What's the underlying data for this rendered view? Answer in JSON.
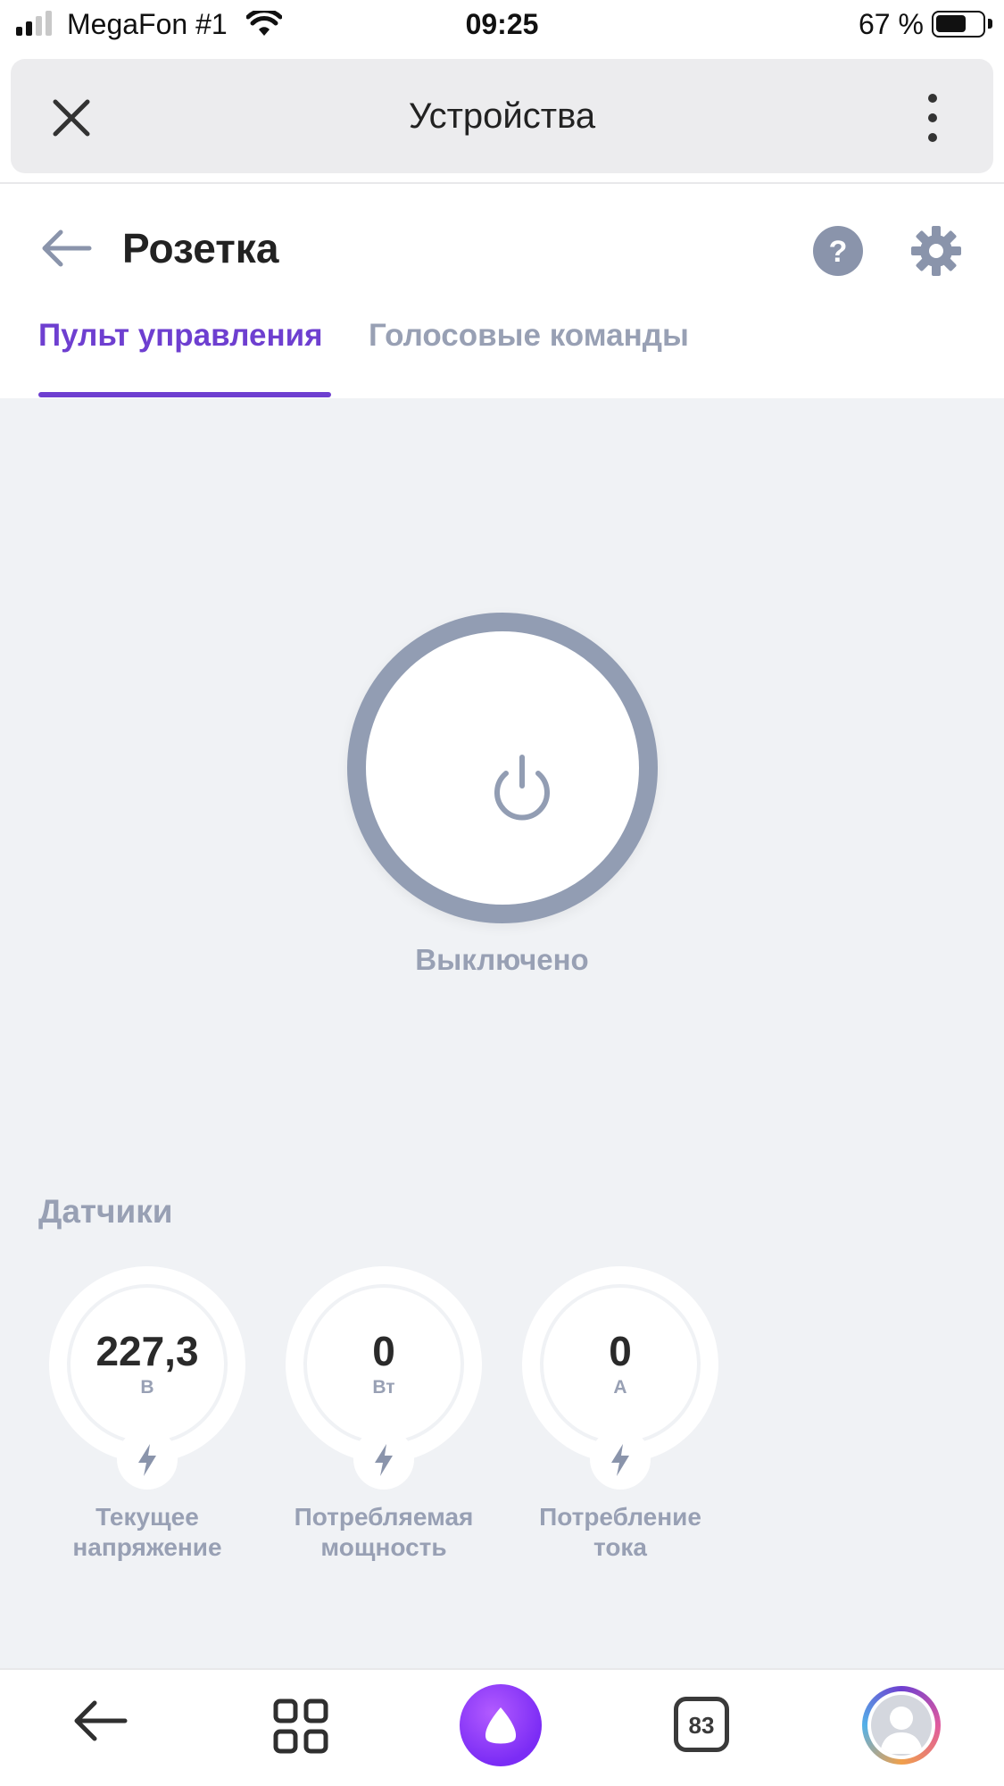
{
  "status_bar": {
    "carrier": "MegaFon #1",
    "time": "09:25",
    "battery_percent": "67 %",
    "battery_level": 0.67,
    "signal_bars": 2
  },
  "header": {
    "title": "Устройства",
    "close_icon": "close-icon",
    "more_icon": "more-vertical-icon"
  },
  "device": {
    "title": "Розетка",
    "tabs": [
      {
        "label": "Пульт управления",
        "active": true
      },
      {
        "label": "Голосовые команды",
        "active": false
      }
    ],
    "accent_color": "#6e3fd0"
  },
  "power": {
    "state_label": "Выключено",
    "ring_color": "#929db3"
  },
  "sensors": {
    "title": "Датчики",
    "items": [
      {
        "value": "227,3",
        "unit": "В",
        "label_line1": "Текущее",
        "label_line2": "напряжение"
      },
      {
        "value": "0",
        "unit": "Вт",
        "label_line1": "Потребляемая",
        "label_line2": "мощность"
      },
      {
        "value": "0",
        "unit": "А",
        "label_line1": "Потребление",
        "label_line2": "тока"
      }
    ]
  },
  "bottom_nav": {
    "tab_count": "83",
    "icons": [
      "back-arrow-icon",
      "grid-icon",
      "alice-icon",
      "tabs-icon",
      "profile-icon"
    ]
  }
}
